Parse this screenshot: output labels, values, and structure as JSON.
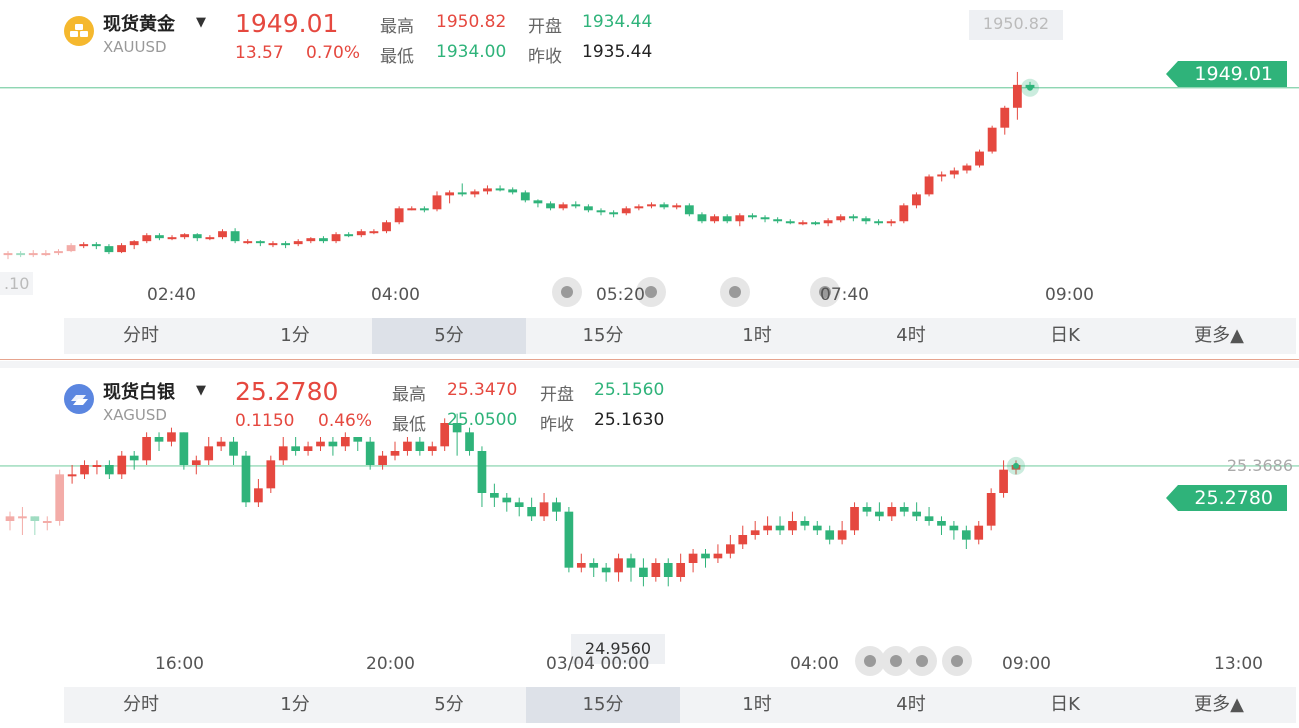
{
  "gold": {
    "name": "现货黄金",
    "symbol": "XAUUSD",
    "price": "1949.01",
    "change": "13.57",
    "change_pct": "0.70%",
    "stats": {
      "high_label": "最高",
      "high": "1950.82",
      "open_label": "开盘",
      "open": "1934.44",
      "low_label": "最低",
      "low": "1934.00",
      "prev_label": "昨收",
      "prev": "1935.44"
    },
    "price_tag": "1949.01",
    "high_marker": "1950.82",
    "left_edge_label": ".10",
    "time_ticks": [
      "02:40",
      "04:00",
      "05:20",
      "07:40",
      "09:00"
    ],
    "tabs": [
      "分时",
      "1分",
      "5分",
      "15分",
      "1时",
      "4时",
      "日K",
      "更多▲"
    ],
    "active_tab": "5分",
    "icon": "gold-bars-icon"
  },
  "silver": {
    "name": "现货白银",
    "symbol": "XAGUSD",
    "price": "25.2780",
    "change": "0.1150",
    "change_pct": "0.46%",
    "stats": {
      "high_label": "最高",
      "high": "25.3470",
      "open_label": "开盘",
      "open": "25.1560",
      "low_label": "最低",
      "low": "25.0500",
      "prev_label": "昨收",
      "prev": "25.1630"
    },
    "price_tag": "25.2780",
    "high_marker": "25.3686",
    "low_marker": "24.9560",
    "time_ticks": [
      "16:00",
      "20:00",
      "03/04 00:00",
      "04:00",
      "09:00",
      "13:00"
    ],
    "tabs": [
      "分时",
      "1分",
      "5分",
      "15分",
      "1时",
      "4时",
      "日K",
      "更多▲"
    ],
    "active_tab": "15分",
    "icon": "silver-bars-icon"
  },
  "colors": {
    "up": "#e5483f",
    "down": "#2fb37a",
    "line": "#7fd0a8"
  },
  "chart_data": [
    {
      "type": "candlestick",
      "title": "现货黄金 XAUUSD",
      "interval": "5分",
      "ylim": [
        1930.1,
        1952.0
      ],
      "x": [
        "02:40",
        "04:00",
        "05:20",
        "07:40",
        "09:00"
      ],
      "current": 1949.01,
      "candles": [
        [
          1932.2,
          1932.4,
          1931.8,
          1932.6
        ],
        [
          1932.4,
          1932.3,
          1932.0,
          1932.6
        ],
        [
          1932.3,
          1932.4,
          1932.0,
          1932.7
        ],
        [
          1932.4,
          1932.4,
          1932.1,
          1932.7
        ],
        [
          1932.4,
          1932.6,
          1932.2,
          1932.8
        ],
        [
          1932.6,
          1933.2,
          1932.5,
          1933.4
        ],
        [
          1933.2,
          1933.3,
          1932.9,
          1933.5
        ],
        [
          1933.3,
          1933.1,
          1932.8,
          1933.5
        ],
        [
          1933.1,
          1932.5,
          1932.3,
          1933.3
        ],
        [
          1932.5,
          1933.2,
          1932.4,
          1933.4
        ],
        [
          1933.2,
          1933.6,
          1932.8,
          1933.7
        ],
        [
          1933.6,
          1934.2,
          1933.4,
          1934.4
        ],
        [
          1934.2,
          1933.9,
          1933.7,
          1934.4
        ],
        [
          1933.9,
          1934.0,
          1933.7,
          1934.2
        ],
        [
          1934.0,
          1934.3,
          1933.8,
          1934.4
        ],
        [
          1934.3,
          1933.9,
          1933.6,
          1934.4
        ],
        [
          1933.9,
          1934.0,
          1933.7,
          1934.2
        ],
        [
          1934.0,
          1934.6,
          1933.8,
          1934.8
        ],
        [
          1934.6,
          1933.6,
          1933.4,
          1934.9
        ],
        [
          1933.6,
          1933.6,
          1933.3,
          1933.8
        ],
        [
          1933.6,
          1933.4,
          1933.1,
          1933.7
        ],
        [
          1933.4,
          1933.4,
          1933.0,
          1933.6
        ],
        [
          1933.4,
          1933.3,
          1932.9,
          1933.6
        ],
        [
          1933.3,
          1933.6,
          1933.1,
          1933.8
        ],
        [
          1933.6,
          1933.9,
          1933.4,
          1934.0
        ],
        [
          1933.9,
          1933.6,
          1933.4,
          1934.1
        ],
        [
          1933.6,
          1934.3,
          1933.4,
          1934.5
        ],
        [
          1934.3,
          1934.2,
          1934.0,
          1934.5
        ],
        [
          1934.2,
          1934.6,
          1934.0,
          1934.8
        ],
        [
          1934.6,
          1934.6,
          1934.3,
          1934.8
        ],
        [
          1934.6,
          1935.5,
          1934.4,
          1935.7
        ],
        [
          1935.5,
          1936.9,
          1935.3,
          1937.1
        ],
        [
          1936.9,
          1936.9,
          1936.7,
          1937.1
        ],
        [
          1936.9,
          1936.8,
          1936.5,
          1937.1
        ],
        [
          1936.8,
          1938.2,
          1936.6,
          1938.6
        ],
        [
          1938.2,
          1938.5,
          1937.4,
          1938.7
        ],
        [
          1938.5,
          1938.3,
          1938.1,
          1939.4
        ],
        [
          1938.3,
          1938.6,
          1938.0,
          1938.8
        ],
        [
          1938.6,
          1938.9,
          1938.3,
          1939.2
        ],
        [
          1938.9,
          1938.8,
          1938.6,
          1939.2
        ],
        [
          1938.8,
          1938.5,
          1938.3,
          1939.0
        ],
        [
          1938.5,
          1937.7,
          1937.5,
          1938.7
        ],
        [
          1937.7,
          1937.4,
          1937.0,
          1937.8
        ],
        [
          1937.4,
          1936.9,
          1936.7,
          1937.6
        ],
        [
          1936.9,
          1937.3,
          1936.7,
          1937.5
        ],
        [
          1937.3,
          1937.1,
          1936.9,
          1937.6
        ],
        [
          1937.1,
          1936.7,
          1936.5,
          1937.3
        ],
        [
          1936.7,
          1936.5,
          1936.2,
          1936.9
        ],
        [
          1936.5,
          1936.4,
          1936.0,
          1936.7
        ],
        [
          1936.4,
          1936.9,
          1936.2,
          1937.1
        ],
        [
          1936.9,
          1937.1,
          1936.7,
          1937.3
        ],
        [
          1937.1,
          1937.3,
          1936.9,
          1937.5
        ],
        [
          1937.3,
          1937.0,
          1936.8,
          1937.5
        ],
        [
          1937.0,
          1937.2,
          1936.8,
          1937.4
        ],
        [
          1937.2,
          1936.3,
          1936.1,
          1937.4
        ],
        [
          1936.3,
          1935.6,
          1935.4,
          1936.5
        ],
        [
          1935.6,
          1936.1,
          1935.4,
          1936.3
        ],
        [
          1936.1,
          1935.6,
          1935.4,
          1936.3
        ],
        [
          1935.6,
          1936.2,
          1935.1,
          1936.4
        ],
        [
          1936.2,
          1936.0,
          1935.8,
          1936.4
        ],
        [
          1936.0,
          1935.8,
          1935.5,
          1936.2
        ],
        [
          1935.8,
          1935.6,
          1935.4,
          1936.0
        ],
        [
          1935.6,
          1935.5,
          1935.3,
          1935.8
        ],
        [
          1935.5,
          1935.5,
          1935.2,
          1935.7
        ],
        [
          1935.5,
          1935.4,
          1935.2,
          1935.6
        ],
        [
          1935.4,
          1935.7,
          1935.1,
          1935.9
        ],
        [
          1935.7,
          1936.1,
          1935.5,
          1936.3
        ],
        [
          1936.1,
          1935.9,
          1935.6,
          1936.3
        ],
        [
          1935.9,
          1935.6,
          1935.3,
          1936.1
        ],
        [
          1935.6,
          1935.4,
          1935.2,
          1935.8
        ],
        [
          1935.4,
          1935.6,
          1935.1,
          1935.8
        ],
        [
          1935.6,
          1937.2,
          1935.4,
          1937.4
        ],
        [
          1937.2,
          1938.3,
          1936.9,
          1938.5
        ],
        [
          1938.3,
          1940.1,
          1938.1,
          1940.3
        ],
        [
          1940.1,
          1940.3,
          1939.6,
          1940.6
        ],
        [
          1940.3,
          1940.7,
          1939.9,
          1941.0
        ],
        [
          1940.7,
          1941.2,
          1940.4,
          1941.4
        ],
        [
          1941.2,
          1942.6,
          1941.0,
          1942.8
        ],
        [
          1942.6,
          1945.0,
          1942.4,
          1945.2
        ],
        [
          1945.0,
          1947.0,
          1944.3,
          1947.2
        ],
        [
          1947.0,
          1949.3,
          1945.8,
          1950.6
        ],
        [
          1949.3,
          1949.0,
          1948.8,
          1949.6
        ]
      ]
    },
    {
      "type": "candlestick",
      "title": "现货白银 XAGUSD",
      "interval": "15分",
      "ylim": [
        24.935,
        25.385
      ],
      "x": [
        "16:00",
        "20:00",
        "03/04 00:00",
        "04:00",
        "09:00",
        "13:00"
      ],
      "current": 25.278,
      "candles": [
        [
          25.16,
          25.17,
          25.14,
          25.18
        ],
        [
          25.17,
          25.17,
          25.13,
          25.19
        ],
        [
          25.17,
          25.16,
          25.13,
          25.17
        ],
        [
          25.16,
          25.16,
          25.14,
          25.17
        ],
        [
          25.16,
          25.26,
          25.15,
          25.27
        ],
        [
          25.26,
          25.26,
          25.24,
          25.28
        ],
        [
          25.26,
          25.28,
          25.25,
          25.29
        ],
        [
          25.28,
          25.28,
          25.26,
          25.29
        ],
        [
          25.28,
          25.26,
          25.25,
          25.29
        ],
        [
          25.26,
          25.3,
          25.25,
          25.31
        ],
        [
          25.3,
          25.29,
          25.27,
          25.31
        ],
        [
          25.29,
          25.34,
          25.28,
          25.35
        ],
        [
          25.34,
          25.33,
          25.31,
          25.35
        ],
        [
          25.33,
          25.35,
          25.32,
          25.36
        ],
        [
          25.35,
          25.28,
          25.27,
          25.35
        ],
        [
          25.28,
          25.29,
          25.26,
          25.3
        ],
        [
          25.29,
          25.32,
          25.28,
          25.34
        ],
        [
          25.32,
          25.33,
          25.31,
          25.34
        ],
        [
          25.33,
          25.3,
          25.28,
          25.34
        ],
        [
          25.3,
          25.2,
          25.19,
          25.31
        ],
        [
          25.2,
          25.23,
          25.19,
          25.25
        ],
        [
          25.23,
          25.29,
          25.22,
          25.3
        ],
        [
          25.29,
          25.32,
          25.28,
          25.34
        ],
        [
          25.32,
          25.31,
          25.3,
          25.34
        ],
        [
          25.31,
          25.32,
          25.3,
          25.33
        ],
        [
          25.32,
          25.33,
          25.31,
          25.34
        ],
        [
          25.33,
          25.32,
          25.3,
          25.34
        ],
        [
          25.32,
          25.34,
          25.31,
          25.35
        ],
        [
          25.34,
          25.33,
          25.31,
          25.34
        ],
        [
          25.33,
          25.28,
          25.27,
          25.34
        ],
        [
          25.28,
          25.3,
          25.27,
          25.31
        ],
        [
          25.3,
          25.31,
          25.29,
          25.33
        ],
        [
          25.31,
          25.33,
          25.3,
          25.34
        ],
        [
          25.33,
          25.31,
          25.3,
          25.34
        ],
        [
          25.31,
          25.32,
          25.3,
          25.33
        ],
        [
          25.32,
          25.37,
          25.31,
          25.38
        ],
        [
          25.37,
          25.35,
          25.3,
          25.39
        ],
        [
          25.35,
          25.31,
          25.3,
          25.36
        ],
        [
          25.31,
          25.22,
          25.19,
          25.32
        ],
        [
          25.22,
          25.21,
          25.19,
          25.24
        ],
        [
          25.21,
          25.2,
          25.18,
          25.22
        ],
        [
          25.2,
          25.19,
          25.17,
          25.21
        ],
        [
          25.19,
          25.17,
          25.16,
          25.21
        ],
        [
          25.17,
          25.2,
          25.16,
          25.22
        ],
        [
          25.2,
          25.18,
          25.16,
          25.21
        ],
        [
          25.18,
          25.06,
          25.05,
          25.19
        ],
        [
          25.06,
          25.07,
          25.05,
          25.09
        ],
        [
          25.07,
          25.06,
          25.04,
          25.08
        ],
        [
          25.06,
          25.05,
          25.03,
          25.07
        ],
        [
          25.05,
          25.08,
          25.03,
          25.09
        ],
        [
          25.08,
          25.06,
          25.03,
          25.09
        ],
        [
          25.06,
          25.04,
          25.02,
          25.08
        ],
        [
          25.04,
          25.07,
          25.03,
          25.08
        ],
        [
          25.07,
          25.04,
          25.02,
          25.08
        ],
        [
          25.04,
          25.07,
          25.03,
          25.09
        ],
        [
          25.07,
          25.09,
          25.05,
          25.1
        ],
        [
          25.09,
          25.08,
          25.06,
          25.1
        ],
        [
          25.08,
          25.09,
          25.07,
          25.11
        ],
        [
          25.09,
          25.11,
          25.08,
          25.13
        ],
        [
          25.11,
          25.13,
          25.1,
          25.15
        ],
        [
          25.13,
          25.14,
          25.12,
          25.16
        ],
        [
          25.14,
          25.15,
          25.13,
          25.17
        ],
        [
          25.15,
          25.14,
          25.13,
          25.17
        ],
        [
          25.14,
          25.16,
          25.13,
          25.18
        ],
        [
          25.16,
          25.15,
          25.14,
          25.17
        ],
        [
          25.15,
          25.14,
          25.13,
          25.16
        ],
        [
          25.14,
          25.12,
          25.11,
          25.15
        ],
        [
          25.12,
          25.14,
          25.11,
          25.16
        ],
        [
          25.14,
          25.19,
          25.13,
          25.2
        ],
        [
          25.19,
          25.18,
          25.17,
          25.2
        ],
        [
          25.18,
          25.17,
          25.16,
          25.2
        ],
        [
          25.17,
          25.19,
          25.16,
          25.2
        ],
        [
          25.19,
          25.18,
          25.17,
          25.2
        ],
        [
          25.18,
          25.17,
          25.16,
          25.2
        ],
        [
          25.17,
          25.16,
          25.15,
          25.19
        ],
        [
          25.16,
          25.15,
          25.13,
          25.17
        ],
        [
          25.15,
          25.14,
          25.12,
          25.16
        ],
        [
          25.14,
          25.12,
          25.1,
          25.15
        ],
        [
          25.12,
          25.15,
          25.11,
          25.16
        ],
        [
          25.15,
          25.22,
          25.14,
          25.23
        ],
        [
          25.22,
          25.27,
          25.21,
          25.29
        ],
        [
          25.27,
          25.28,
          25.26,
          25.29
        ]
      ]
    }
  ]
}
